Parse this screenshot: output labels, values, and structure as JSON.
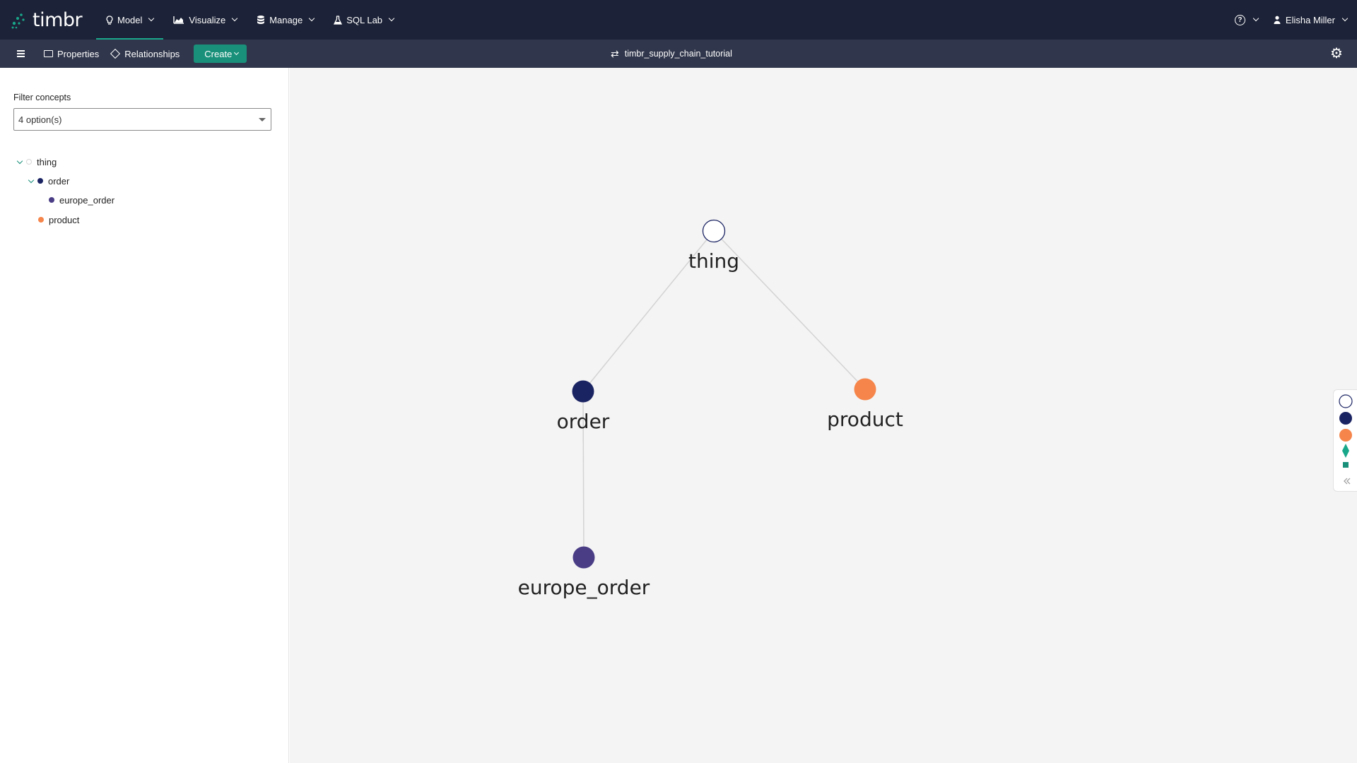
{
  "app": {
    "name": "timbr"
  },
  "nav": {
    "items": [
      {
        "label": "Model",
        "icon": "bulb-icon"
      },
      {
        "label": "Visualize",
        "icon": "area-chart-icon"
      },
      {
        "label": "Manage",
        "icon": "database-icon"
      },
      {
        "label": "SQL Lab",
        "icon": "flask-icon"
      }
    ]
  },
  "user": {
    "name": "Elisha Miller"
  },
  "toolbar": {
    "properties_label": "Properties",
    "relationships_label": "Relationships",
    "create_label": "Create",
    "ontology_name": "timbr_supply_chain_tutorial"
  },
  "sidebar": {
    "filter_label": "Filter concepts",
    "filter_value": "4 option(s)",
    "tree": [
      {
        "label": "thing",
        "color": "#ffffff",
        "expanded": true
      },
      {
        "label": "order",
        "color": "#1b2463",
        "expanded": true
      },
      {
        "label": "europe_order",
        "color": "#4a3d86"
      },
      {
        "label": "product",
        "color": "#f5854a"
      }
    ]
  },
  "graph": {
    "nodes": [
      {
        "label": "thing",
        "color": "#ffffff",
        "stroke": "#1b2463"
      },
      {
        "label": "order",
        "color": "#1b2463"
      },
      {
        "label": "product",
        "color": "#f5854a"
      },
      {
        "label": "europe_order",
        "color": "#4a3d86"
      }
    ],
    "edges": [
      [
        "thing",
        "order"
      ],
      [
        "thing",
        "product"
      ],
      [
        "order",
        "europe_order"
      ]
    ]
  },
  "legend": {
    "items": [
      {
        "shape": "circle",
        "color": "#ffffff"
      },
      {
        "shape": "circle",
        "color": "#1b2463"
      },
      {
        "shape": "circle",
        "color": "#f5854a"
      },
      {
        "shape": "diamond",
        "color": "#19a78a"
      },
      {
        "shape": "square",
        "color": "#19907a"
      }
    ],
    "collapse_icon": "double-chevron-left-icon"
  }
}
